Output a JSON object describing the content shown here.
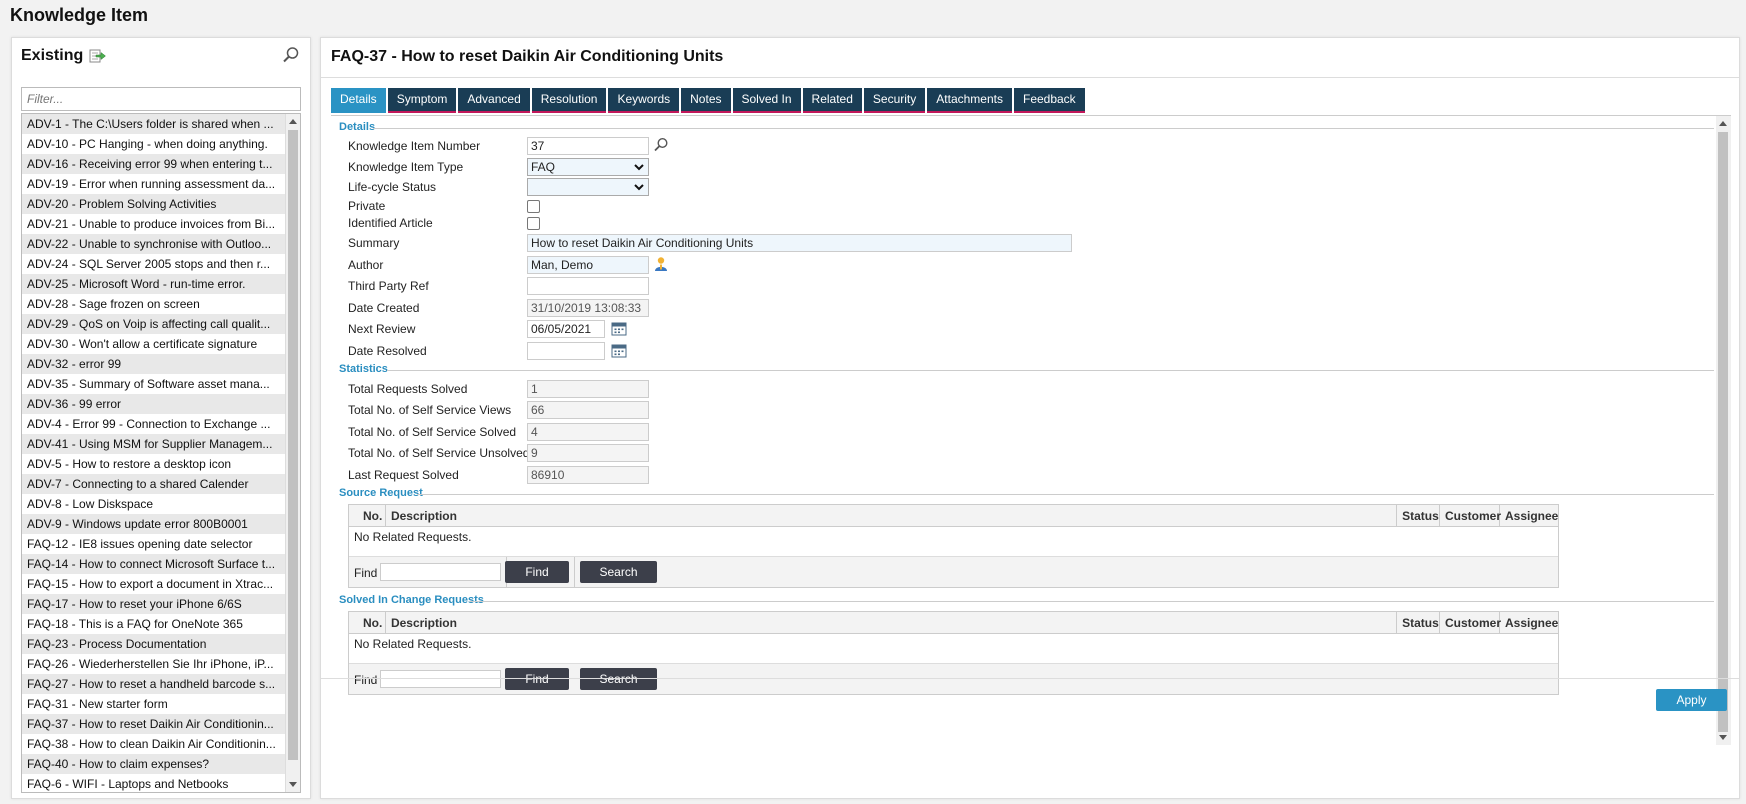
{
  "app": {
    "title": "Knowledge Item"
  },
  "left": {
    "header": "Existing",
    "filter_placeholder": "Filter...",
    "items": [
      "ADV-1 - The C:\\Users folder is shared when ...",
      "ADV-10 - PC Hanging - when doing anything.",
      "ADV-16 - Receiving error 99 when entering t...",
      "ADV-19 - Error when running assessment da...",
      "ADV-20 - Problem Solving Activities",
      "ADV-21 - Unable to produce invoices from Bi...",
      "ADV-22 - Unable to synchronise with Outloo...",
      "ADV-24 - SQL Server 2005 stops and then r...",
      "ADV-25 - Microsoft Word - run-time error.",
      "ADV-28 - Sage frozen on screen",
      "ADV-29 - QoS on Voip is affecting call qualit...",
      "ADV-30 - Won't allow a certificate signature",
      "ADV-32 - error 99",
      "ADV-35 - Summary of Software asset mana...",
      "ADV-36 - 99 error",
      "ADV-4 - Error 99 - Connection to Exchange ...",
      "ADV-41 - Using MSM for Supplier Managem...",
      "ADV-5 - How to restore a desktop icon",
      "ADV-7 - Connecting to a shared Calender",
      "ADV-8 - Low Diskspace",
      "ADV-9 - Windows update error 800B0001",
      "FAQ-12 - IE8 issues opening date selector",
      "FAQ-14 - How to connect Microsoft Surface t...",
      "FAQ-15 - How to export a document in Xtrac...",
      "FAQ-17 - How to reset your iPhone 6/6S",
      "FAQ-18 - This is a FAQ for OneNote 365",
      "FAQ-23 - Process Documentation",
      "FAQ-26 - Wiederherstellen Sie Ihr iPhone, iP...",
      "FAQ-27 - How to reset a handheld barcode s...",
      "FAQ-31 - New starter form",
      "FAQ-37 - How to reset Daikin Air Conditionin...",
      "FAQ-38 - How to clean Daikin Air Conditionin...",
      "FAQ-40 - How to claim expenses?",
      "FAQ-6 - WIFI - Laptops and Netbooks"
    ]
  },
  "main": {
    "title": "FAQ-37 - How to reset Daikin Air Conditioning Units",
    "tabs": [
      "Details",
      "Symptom",
      "Advanced",
      "Resolution",
      "Keywords",
      "Notes",
      "Solved In",
      "Related",
      "Security",
      "Attachments",
      "Feedback"
    ],
    "active_tab": "Details",
    "details": {
      "section": "Details",
      "number_label": "Knowledge Item Number",
      "number": "37",
      "type_label": "Knowledge Item Type",
      "type": "FAQ",
      "lifecycle_label": "Life-cycle Status",
      "lifecycle": "",
      "private_label": "Private",
      "private": false,
      "identified_label": "Identified Article",
      "identified": false,
      "summary_label": "Summary",
      "summary": "How to reset Daikin Air Conditioning Units",
      "author_label": "Author",
      "author": "Man, Demo",
      "thirdparty_label": "Third Party Ref",
      "thirdparty": "",
      "created_label": "Date Created",
      "created": "31/10/2019 13:08:33",
      "nextreview_label": "Next Review",
      "nextreview": "06/05/2021",
      "resolved_label": "Date Resolved",
      "resolved": ""
    },
    "statistics": {
      "section": "Statistics",
      "solved_label": "Total Requests Solved",
      "solved": "1",
      "views_label": "Total No. of Self Service Views",
      "views": "66",
      "ss_solved_label": "Total No. of Self Service Solved",
      "ss_solved": "4",
      "ss_unsolved_label": "Total No. of Self Service Unsolved",
      "ss_unsolved": "9",
      "last_label": "Last Request Solved",
      "last": "86910"
    },
    "source_request": {
      "section": "Source Request",
      "columns": [
        "No.",
        "Description",
        "Status",
        "Customer",
        "Assignee"
      ],
      "empty": "No Related Requests.",
      "find_label": "Find",
      "find_button": "Find",
      "search_button": "Search"
    },
    "change_requests": {
      "section": "Solved In Change Requests",
      "columns": [
        "No.",
        "Description",
        "Status",
        "Customer",
        "Assignee"
      ],
      "empty": "No Related Requests.",
      "find_label": "Find",
      "find_button": "Find",
      "search_button": "Search"
    },
    "apply": "Apply"
  },
  "colors": {
    "tab_bg": "#1a3d55",
    "tab_active": "#2a93c4",
    "tab_underline": "#c2185b",
    "section": "#2a8ec0",
    "button_dark": "#3c3f4a",
    "apply": "#2a93c4"
  }
}
